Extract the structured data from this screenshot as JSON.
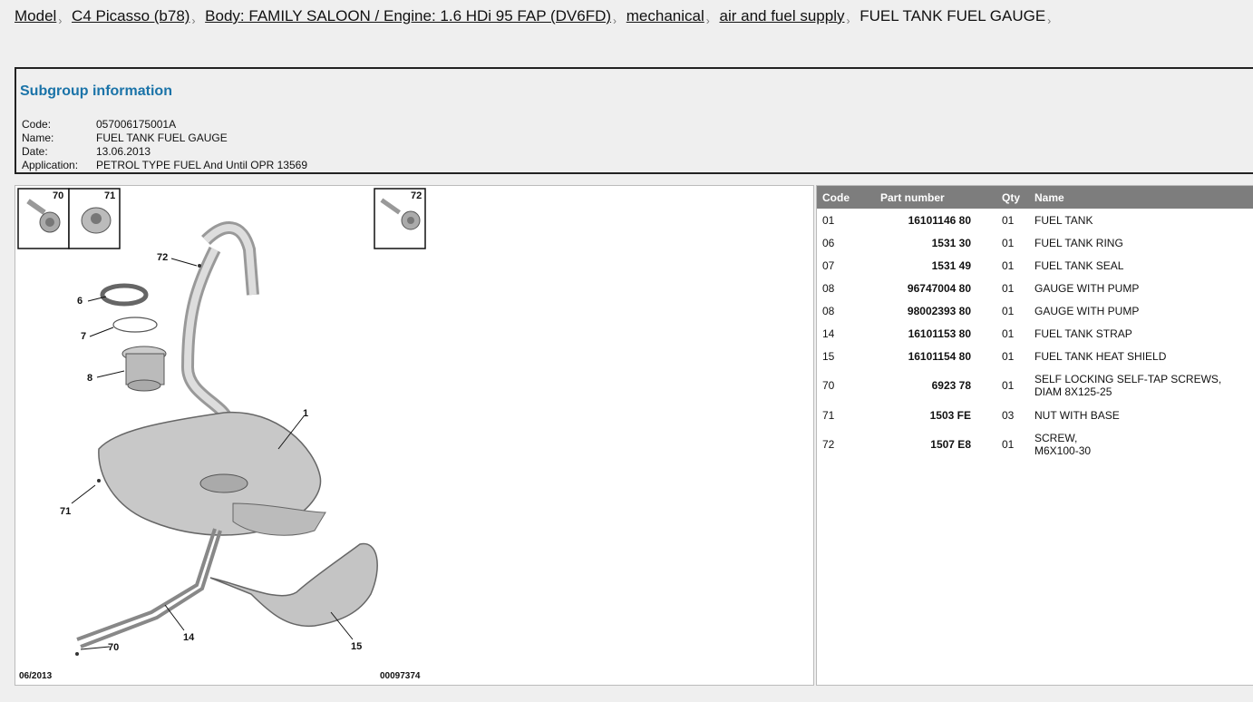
{
  "breadcrumb": {
    "items": [
      "Model",
      "C4 Picasso (b78)",
      "Body: FAMILY SALOON / Engine: 1.6 HDi 95 FAP (DV6FD)",
      "mechanical",
      "air and fuel supply"
    ],
    "current": "FUEL TANK FUEL GAUGE"
  },
  "subgroup": {
    "heading": "Subgroup information",
    "code_label": "Code:",
    "code": "057006175001A",
    "name_label": "Name:",
    "name": "FUEL TANK FUEL GAUGE",
    "date_label": "Date:",
    "date": "13.06.2013",
    "application_label": "Application:",
    "application": "PETROL TYPE FUEL And Until OPR 13569"
  },
  "diagram": {
    "date_stamp": "06/2013",
    "ref_number": "00097374",
    "inset_labels": [
      "70",
      "71",
      "72"
    ],
    "callouts": [
      "72",
      "6",
      "7",
      "8",
      "1",
      "71",
      "14",
      "70",
      "15"
    ]
  },
  "parts_table": {
    "headers": {
      "code": "Code",
      "part_number": "Part number",
      "qty": "Qty",
      "name": "Name"
    },
    "rows": [
      {
        "code": "01",
        "part_number": "16101146 80",
        "qty": "01",
        "name": "FUEL TANK",
        "name2": ""
      },
      {
        "code": "06",
        "part_number": "1531 30",
        "qty": "01",
        "name": "FUEL TANK RING",
        "name2": ""
      },
      {
        "code": "07",
        "part_number": "1531 49",
        "qty": "01",
        "name": "FUEL TANK SEAL",
        "name2": ""
      },
      {
        "code": "08",
        "part_number": "96747004 80",
        "qty": "01",
        "name": "GAUGE WITH PUMP",
        "name2": ""
      },
      {
        "code": "08",
        "part_number": "98002393 80",
        "qty": "01",
        "name": "GAUGE WITH PUMP",
        "name2": ""
      },
      {
        "code": "14",
        "part_number": "16101153 80",
        "qty": "01",
        "name": "FUEL TANK STRAP",
        "name2": ""
      },
      {
        "code": "15",
        "part_number": "16101154 80",
        "qty": "01",
        "name": "FUEL TANK HEAT SHIELD",
        "name2": ""
      },
      {
        "code": "70",
        "part_number": "6923 78",
        "qty": "01",
        "name": "SELF LOCKING SELF-TAP SCREWS,",
        "name2": "DIAM 8X125-25"
      },
      {
        "code": "71",
        "part_number": "1503 FE",
        "qty": "03",
        "name": "NUT WITH BASE",
        "name2": ""
      },
      {
        "code": "72",
        "part_number": "1507 E8",
        "qty": "01",
        "name": "SCREW,",
        "name2": "M6X100-30"
      }
    ]
  }
}
